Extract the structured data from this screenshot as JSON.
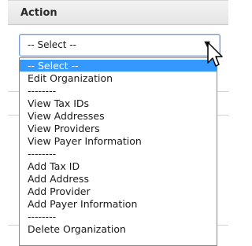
{
  "header": {
    "label": "Action"
  },
  "select": {
    "value": "-- Select --",
    "arrow": "▼",
    "options": [
      "-- Select --",
      "Edit Organization",
      "--------",
      "View Tax IDs",
      "View Addresses",
      "View Providers",
      "View Payer Information",
      "--------",
      "Add Tax ID",
      "Add Address",
      "Add Provider",
      "Add Payer Information",
      "--------",
      "Delete Organization"
    ]
  },
  "colors": {
    "highlight": "#3399ff",
    "focus_border": "#7a9cd3"
  },
  "icons": {
    "cursor": "arrow-pointer-icon"
  }
}
